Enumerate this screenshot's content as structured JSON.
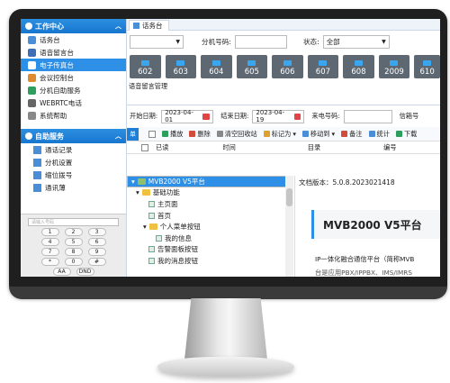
{
  "sidebar": {
    "group1_title": "工作中心",
    "items": [
      "话务台",
      "语音留言台",
      "电子传真台",
      "会议控制台",
      "分机自助服务",
      "WEBRTC电话",
      "系统帮助"
    ],
    "group2_title": "自助服务",
    "sub_items": [
      "通话记录",
      "分机设置",
      "缩位拨号",
      "通讯薄"
    ]
  },
  "keypad": {
    "placeholder": "请输入号码",
    "rows": [
      [
        "1",
        "2",
        "3"
      ],
      [
        "4",
        "5",
        "6"
      ],
      [
        "7",
        "8",
        "9"
      ],
      [
        "*",
        "0",
        "#"
      ]
    ],
    "bottom": [
      "AA",
      "DND"
    ]
  },
  "tab": {
    "label": "话务台"
  },
  "filters": {
    "ext_label": "分机号码:",
    "status_label": "状态:",
    "status_value": "全部"
  },
  "extensions": [
    "602",
    "603",
    "604",
    "605",
    "606",
    "607",
    "608",
    "2009",
    "610"
  ],
  "voicemail": {
    "section_title": "语音留言管理",
    "start_label": "开始日期:",
    "start_value": "2023-04-01",
    "end_label": "结束日期:",
    "end_value": "2023-04-19",
    "caller_label": "来电号码:",
    "box_label": "信箱号"
  },
  "toolbar": {
    "first": "单",
    "play": "播放",
    "delete": "删除",
    "clear": "清空回收站",
    "mark": "标记为",
    "move": "移动到",
    "note": "备注",
    "stats": "统计",
    "download": "下载"
  },
  "columns": [
    "已读",
    "时间",
    "目录",
    "编号"
  ],
  "tree": [
    {
      "label": "MVB2000 V5平台",
      "type": "root"
    },
    {
      "label": "基础功能",
      "type": "folder"
    },
    {
      "label": "主页面",
      "type": "leaf"
    },
    {
      "label": "首页",
      "type": "leaf"
    },
    {
      "label": "个人菜单按钮",
      "type": "folder"
    },
    {
      "label": "我的信息",
      "type": "leaf"
    },
    {
      "label": "告警面板按钮",
      "type": "leaf"
    },
    {
      "label": "我的消息按钮",
      "type": "leaf"
    }
  ],
  "doc": {
    "version": "文档版本：5.0.8.2023021418",
    "title": "MVB2000 V5平台",
    "para": "IP一体化融合通信平台（简称MVB",
    "para2": "台是应用PBX/IPPBX、IMS/IMRS"
  },
  "colors": {
    "accent": "#2d8fe6",
    "ext_tile": "#5e6872"
  }
}
